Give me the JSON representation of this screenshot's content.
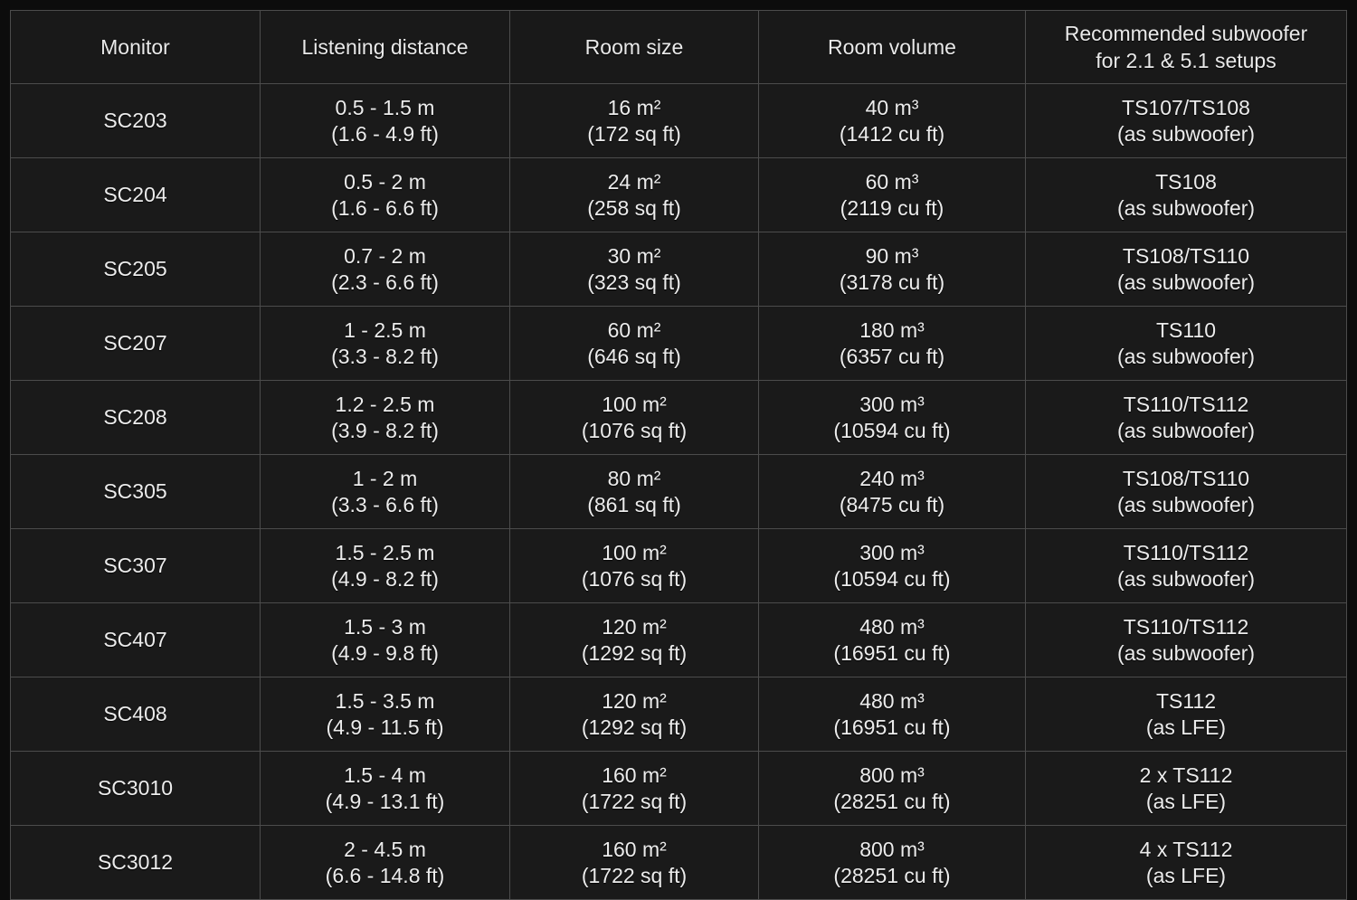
{
  "table": {
    "columns": [
      {
        "key": "monitor",
        "label": "Monitor"
      },
      {
        "key": "distance",
        "label": "Listening distance"
      },
      {
        "key": "roomsize",
        "label": "Room size"
      },
      {
        "key": "roomvol",
        "label": "Room volume"
      },
      {
        "key": "subwoofer",
        "label_line1": "Recommended subwoofer",
        "label_line2": "for 2.1 & 5.1 setups"
      }
    ],
    "rows": [
      {
        "monitor": "SC203",
        "distance_metric": "0.5 - 1.5 m",
        "distance_imperial": "(1.6 - 4.9 ft)",
        "roomsize_metric": "16 m²",
        "roomsize_imperial": "(172 sq ft)",
        "roomvol_metric": "40 m³",
        "roomvol_imperial": "(1412 cu ft)",
        "subwoofer_model": "TS107/TS108",
        "subwoofer_role": "(as subwoofer)"
      },
      {
        "monitor": "SC204",
        "distance_metric": "0.5 - 2 m",
        "distance_imperial": "(1.6 - 6.6 ft)",
        "roomsize_metric": "24 m²",
        "roomsize_imperial": "(258 sq ft)",
        "roomvol_metric": "60 m³",
        "roomvol_imperial": "(2119 cu ft)",
        "subwoofer_model": "TS108",
        "subwoofer_role": "(as subwoofer)"
      },
      {
        "monitor": "SC205",
        "distance_metric": "0.7 - 2 m",
        "distance_imperial": "(2.3 - 6.6 ft)",
        "roomsize_metric": "30 m²",
        "roomsize_imperial": "(323 sq ft)",
        "roomvol_metric": "90 m³",
        "roomvol_imperial": "(3178 cu ft)",
        "subwoofer_model": "TS108/TS110",
        "subwoofer_role": "(as subwoofer)"
      },
      {
        "monitor": "SC207",
        "distance_metric": "1 - 2.5 m",
        "distance_imperial": "(3.3 - 8.2 ft)",
        "roomsize_metric": "60 m²",
        "roomsize_imperial": "(646 sq ft)",
        "roomvol_metric": "180 m³",
        "roomvol_imperial": "(6357 cu ft)",
        "subwoofer_model": "TS110",
        "subwoofer_role": "(as subwoofer)"
      },
      {
        "monitor": "SC208",
        "distance_metric": "1.2 - 2.5 m",
        "distance_imperial": "(3.9 - 8.2 ft)",
        "roomsize_metric": "100 m²",
        "roomsize_imperial": "(1076 sq ft)",
        "roomvol_metric": "300 m³",
        "roomvol_imperial": "(10594 cu ft)",
        "subwoofer_model": "TS110/TS112",
        "subwoofer_role": "(as subwoofer)"
      },
      {
        "monitor": "SC305",
        "distance_metric": "1 - 2 m",
        "distance_imperial": "(3.3 - 6.6 ft)",
        "roomsize_metric": "80 m²",
        "roomsize_imperial": "(861 sq ft)",
        "roomvol_metric": "240 m³",
        "roomvol_imperial": "(8475 cu ft)",
        "subwoofer_model": "TS108/TS110",
        "subwoofer_role": "(as subwoofer)"
      },
      {
        "monitor": "SC307",
        "distance_metric": "1.5 - 2.5 m",
        "distance_imperial": "(4.9 - 8.2 ft)",
        "roomsize_metric": "100 m²",
        "roomsize_imperial": "(1076 sq ft)",
        "roomvol_metric": "300 m³",
        "roomvol_imperial": "(10594 cu ft)",
        "subwoofer_model": "TS110/TS112",
        "subwoofer_role": "(as subwoofer)"
      },
      {
        "monitor": "SC407",
        "distance_metric": "1.5 - 3 m",
        "distance_imperial": "(4.9 - 9.8 ft)",
        "roomsize_metric": "120 m²",
        "roomsize_imperial": "(1292 sq ft)",
        "roomvol_metric": "480 m³",
        "roomvol_imperial": "(16951 cu ft)",
        "subwoofer_model": "TS110/TS112",
        "subwoofer_role": "(as subwoofer)"
      },
      {
        "monitor": "SC408",
        "distance_metric": "1.5 - 3.5 m",
        "distance_imperial": "(4.9 - 11.5 ft)",
        "roomsize_metric": "120 m²",
        "roomsize_imperial": "(1292 sq ft)",
        "roomvol_metric": "480 m³",
        "roomvol_imperial": "(16951 cu ft)",
        "subwoofer_model": "TS112",
        "subwoofer_role": "(as LFE)"
      },
      {
        "monitor": "SC3010",
        "distance_metric": "1.5 - 4 m",
        "distance_imperial": "(4.9 - 13.1 ft)",
        "roomsize_metric": "160 m²",
        "roomsize_imperial": "(1722 sq ft)",
        "roomvol_metric": "800 m³",
        "roomvol_imperial": "(28251 cu ft)",
        "subwoofer_model": "2 x TS112",
        "subwoofer_role": "(as LFE)"
      },
      {
        "monitor": "SC3012",
        "distance_metric": "2 - 4.5 m",
        "distance_imperial": "(6.6 - 14.8 ft)",
        "roomsize_metric": "160 m²",
        "roomsize_imperial": "(1722 sq ft)",
        "roomvol_metric": "800 m³",
        "roomvol_imperial": "(28251 cu ft)",
        "subwoofer_model": "4 x TS112",
        "subwoofer_role": "(as LFE)"
      }
    ]
  },
  "colors": {
    "page_background": "#0c0c0c",
    "cell_background": "#1a1a1a",
    "border": "#4c4c4c",
    "text": "#ececec"
  }
}
